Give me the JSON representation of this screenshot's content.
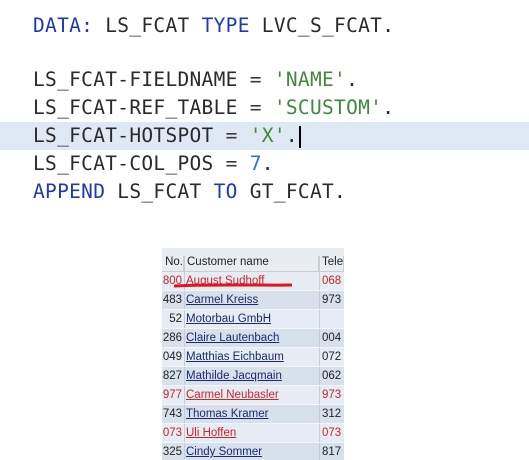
{
  "editor": {
    "partial_top_line": "",
    "lines": {
      "data_kw": "DATA:",
      "data_var": "LS_FCAT",
      "type_kw": "TYPE",
      "type_name": "LVC_S_FCAT",
      "l2_lhs": "LS_FCAT-FIELDNAME",
      "l2_op": "=",
      "l2_val": "'NAME'",
      "l3_lhs": "LS_FCAT-REF_TABLE",
      "l3_op": "=",
      "l3_val": "'SCUSTOM'",
      "l4_lhs": "LS_FCAT-HOTSPOT",
      "l4_op": "=",
      "l4_val": "'X'",
      "l5_lhs": "LS_FCAT-COL_POS",
      "l5_op": "=",
      "l5_val": "7",
      "append_kw": "APPEND",
      "append_var": "LS_FCAT",
      "to_kw": "TO",
      "append_target": "GT_FCAT",
      "period": "."
    }
  },
  "alv": {
    "headers": {
      "no": "No.",
      "name": "Customer name",
      "tel": "Tele"
    },
    "rows": [
      {
        "no": "800",
        "name": "August Sudhoff",
        "tel": "068",
        "highlight": true
      },
      {
        "no": "483",
        "name": "Carmel Kreiss",
        "tel": "973",
        "highlight": false
      },
      {
        "no": "52",
        "name": "Motorbau GmbH",
        "tel": "",
        "highlight": false
      },
      {
        "no": "286",
        "name": "Claire Lautenbach",
        "tel": "004",
        "highlight": false
      },
      {
        "no": "049",
        "name": "Matthias Eichbaum",
        "tel": "072",
        "highlight": false
      },
      {
        "no": "827",
        "name": "Mathilde Jacqmain",
        "tel": "062",
        "highlight": false
      },
      {
        "no": "977",
        "name": "Carmel Neubasler",
        "tel": "973",
        "highlight": true
      },
      {
        "no": "743",
        "name": "Thomas Kramer",
        "tel": "312",
        "highlight": false
      },
      {
        "no": "073",
        "name": "Uli Hoffen",
        "tel": "073",
        "highlight": true
      },
      {
        "no": "325",
        "name": "Cindy Sommer",
        "tel": "817",
        "highlight": false
      }
    ]
  },
  "colors": {
    "keyword": "#1c39b8",
    "string": "#3f8a3a",
    "number": "#3a6ec4",
    "active_line": "#dfe9f4",
    "hotspot_red": "#c8262c",
    "annotation": "#e0161c"
  }
}
